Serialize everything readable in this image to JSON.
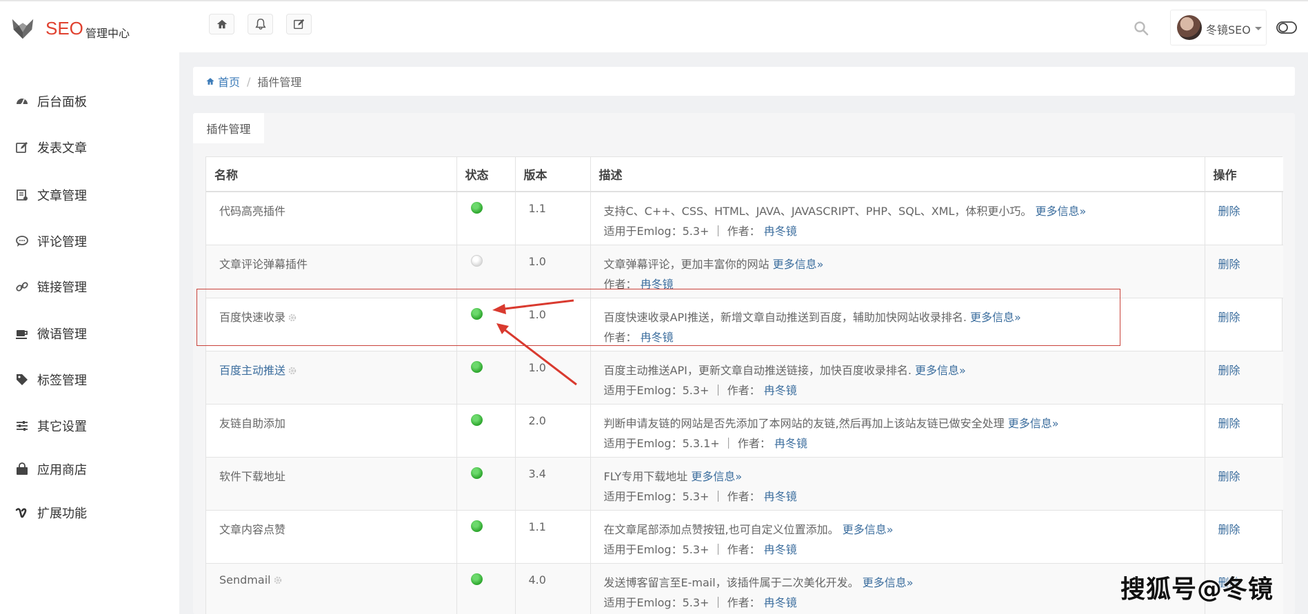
{
  "brand": {
    "name": "SEO",
    "subtitle": "管理中心"
  },
  "user": {
    "name": "冬镜SEO"
  },
  "sidebar": {
    "items": [
      {
        "label": "后台面板",
        "icon": "dashboard-icon"
      },
      {
        "label": "发表文章",
        "icon": "edit-icon"
      },
      {
        "label": "文章管理",
        "icon": "article-icon"
      },
      {
        "label": "评论管理",
        "icon": "comment-icon"
      },
      {
        "label": "链接管理",
        "icon": "link-icon"
      },
      {
        "label": "微语管理",
        "icon": "cup-icon"
      },
      {
        "label": "标签管理",
        "icon": "tag-icon"
      },
      {
        "label": "其它设置",
        "icon": "sliders-icon"
      },
      {
        "label": "应用商店",
        "icon": "shop-bag-icon"
      },
      {
        "label": "扩展功能",
        "icon": "vimeo-v-icon"
      }
    ]
  },
  "breadcrumb": {
    "home": "首页",
    "sep": "/",
    "current": "插件管理"
  },
  "tab": {
    "label": "插件管理"
  },
  "table": {
    "headers": [
      "名称",
      "状态",
      "版本",
      "描述",
      "操作"
    ],
    "rows": [
      {
        "name": "代码高亮插件",
        "status": "on",
        "version": "1.1",
        "desc": "支持C、C++、CSS、HTML、JAVA、JAVASCRIPT、PHP、SQL、XML，体积更小巧。",
        "more": "更多信息»",
        "compat": "适用于Emlog：5.3+ ｜ 作者：",
        "author": "冉冬镜",
        "op": "删除"
      },
      {
        "name": "文章评论弹幕插件",
        "status": "off",
        "version": "1.0",
        "desc": "文章弹幕评论，更加丰富你的网站",
        "more": "更多信息»",
        "compat": "作者：",
        "author": "冉冬镜",
        "op": "删除"
      },
      {
        "name": "百度快速收录",
        "status": "on",
        "version": "1.0",
        "desc": "百度快速收录API推送，新增文章自动推送到百度，辅助加快网站收录排名.",
        "more": "更多信息»",
        "compat": "作者：",
        "author": "冉冬镜",
        "op": "删除",
        "gear": true
      },
      {
        "name": "百度主动推送",
        "status": "on",
        "version": "1.0",
        "desc": "百度主动推送API，更新文章自动推送链接，加快百度收录排名.",
        "more": "更多信息»",
        "compat": "适用于Emlog：5.3+ ｜ 作者：",
        "author": "冉冬镜",
        "op": "删除",
        "gear": true,
        "link": true
      },
      {
        "name": "友链自助添加",
        "status": "on",
        "version": "2.0",
        "desc": "判断申请友链的网站是否先添加了本网站的友链,然后再加上该站友链已做安全处理",
        "more": "更多信息»",
        "compat": "适用于Emlog：5.3.1+ ｜ 作者：",
        "author": "冉冬镜",
        "op": "删除"
      },
      {
        "name": "软件下载地址",
        "status": "on",
        "version": "3.4",
        "desc": "FLY专用下载地址",
        "more": "更多信息»",
        "compat": "适用于Emlog：5.3+ ｜ 作者：",
        "author": "冉冬镜",
        "op": "删除"
      },
      {
        "name": "文章内容点赞",
        "status": "on",
        "version": "1.1",
        "desc": "在文章尾部添加点赞按钮,也可自定义位置添加。",
        "more": "更多信息»",
        "compat": "适用于Emlog：5.3+ ｜ 作者：",
        "author": "冉冬镜",
        "op": "删除"
      },
      {
        "name": "Sendmail",
        "status": "on",
        "version": "4.0",
        "desc": "发送博客留言至E-mail，该插件属于二次美化开发。",
        "more": "更多信息»",
        "compat": "适用于Emlog：5.3+ ｜ 作者：",
        "author": "冉冬镜",
        "op": "删除",
        "gear": true
      }
    ]
  },
  "watermark": "搜狐号@冬镜",
  "colors": {
    "brand": "#e0412f",
    "link": "#3c6e9e",
    "status_on": "#2da52d",
    "highlight": "#c9423a"
  }
}
